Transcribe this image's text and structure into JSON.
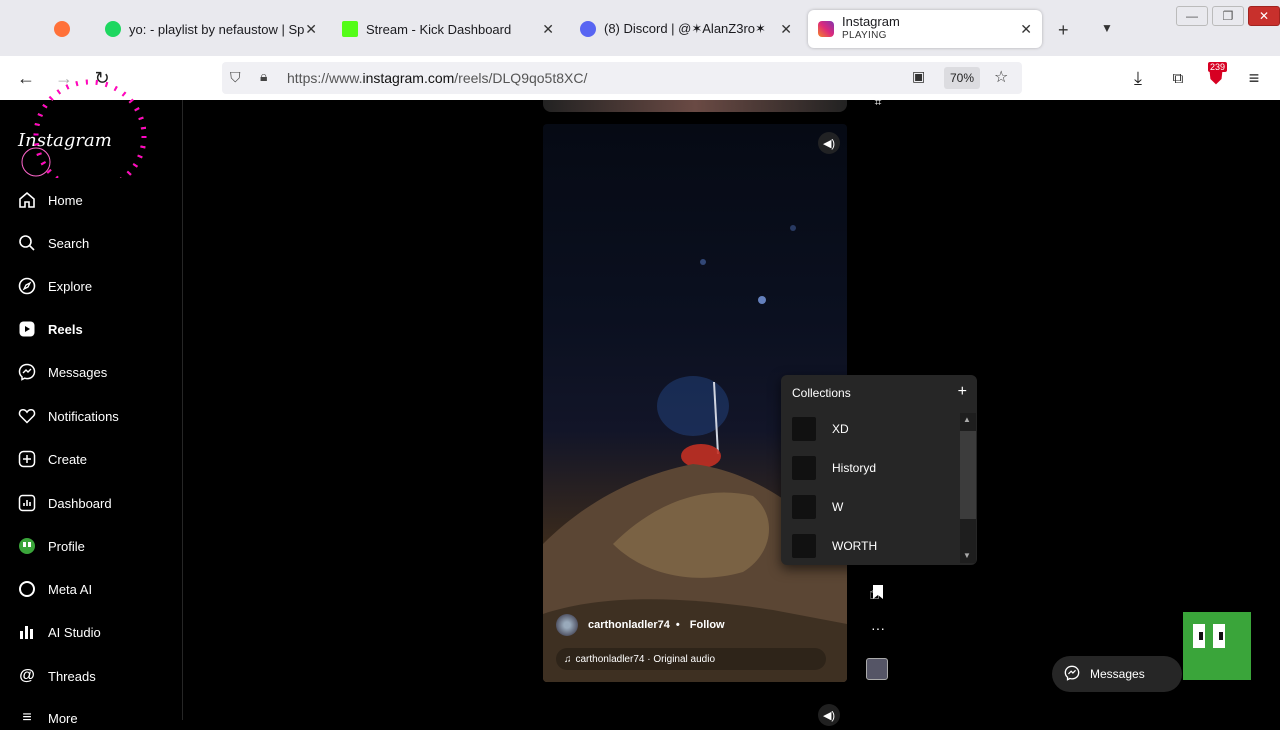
{
  "browser": {
    "tabs": [
      {
        "title": "",
        "favicon_color": "#ff7139"
      },
      {
        "title": "yo: - playlist by nefaustow | Sp",
        "favicon_color": "#1ed760"
      },
      {
        "title": "Stream - Kick Dashboard",
        "favicon_color": "#53fc18"
      },
      {
        "title": "(8) Discord | @✶AlanZ3ro✶",
        "favicon_color": "#5865f2"
      },
      {
        "title": "Instagram",
        "subtitle": "PLAYING",
        "favicon_color": "#e1306c"
      }
    ],
    "url_prefix": "https://www.",
    "url_domain": "instagram.com",
    "url_path": "/reels/DLQ9qo5t8XC/",
    "zoom": "70%",
    "extension_badge": "239"
  },
  "sidebar": {
    "logo": "Instagram",
    "items": [
      {
        "label": "Home",
        "icon": "home-icon"
      },
      {
        "label": "Search",
        "icon": "search-icon"
      },
      {
        "label": "Explore",
        "icon": "compass-icon"
      },
      {
        "label": "Reels",
        "icon": "reels-icon"
      },
      {
        "label": "Messages",
        "icon": "messenger-icon"
      },
      {
        "label": "Notifications",
        "icon": "heart-icon"
      },
      {
        "label": "Create",
        "icon": "plus-square-icon"
      },
      {
        "label": "Dashboard",
        "icon": "chart-icon"
      },
      {
        "label": "Profile",
        "icon": "avatar"
      },
      {
        "label": "Meta AI",
        "icon": "meta-ai-icon"
      },
      {
        "label": "AI Studio",
        "icon": "ai-studio-icon"
      },
      {
        "label": "Threads",
        "icon": "threads-icon"
      },
      {
        "label": "More",
        "icon": "menu-icon"
      }
    ]
  },
  "reel": {
    "username": "carthonladler74",
    "separator": "•",
    "follow_label": "Follow",
    "audio": "carthonladler74 · Original audio"
  },
  "collections": {
    "title": "Collections",
    "items": [
      "XD",
      "Historyd",
      "W",
      "WORTH"
    ]
  },
  "messages_pill": {
    "label": "Messages"
  }
}
